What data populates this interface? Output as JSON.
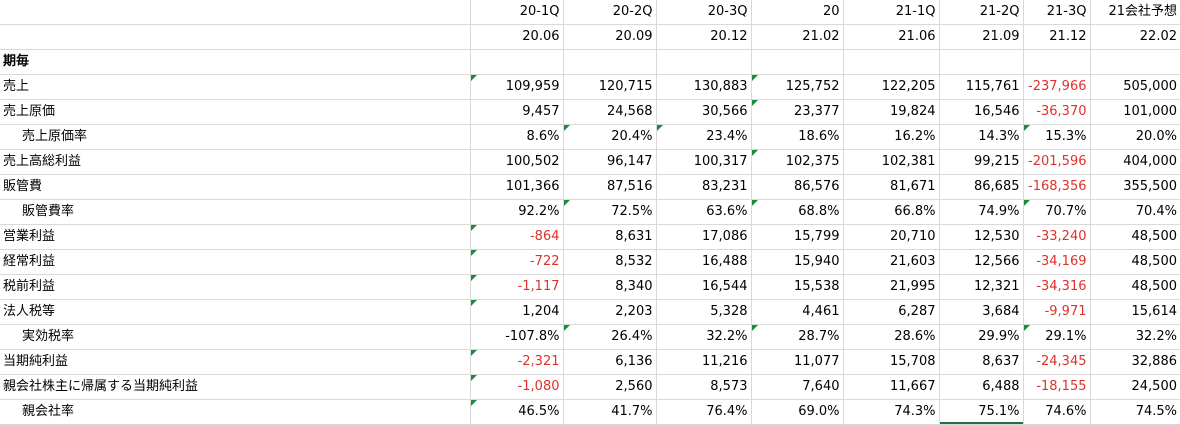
{
  "header": {
    "periods": [
      "20-1Q",
      "20-2Q",
      "20-3Q",
      "20",
      "21-1Q",
      "21-2Q",
      "21-3Q",
      "21会社予想"
    ],
    "dates": [
      "20.06",
      "20.09",
      "20.12",
      "21.02",
      "21.06",
      "21.09",
      "21.12",
      "22.02"
    ]
  },
  "section_label": "期毎",
  "rows": [
    {
      "label": "売上",
      "indent": false,
      "values": [
        "109,959",
        "120,715",
        "130,883",
        "125,752",
        "122,205",
        "115,761",
        "-237,966",
        "505,000"
      ]
    },
    {
      "label": "売上原価",
      "indent": false,
      "values": [
        "9,457",
        "24,568",
        "30,566",
        "23,377",
        "19,824",
        "16,546",
        "-36,370",
        "101,000"
      ]
    },
    {
      "label": "売上原価率",
      "indent": true,
      "values": [
        "8.6%",
        "20.4%",
        "23.4%",
        "18.6%",
        "16.2%",
        "14.3%",
        "15.3%",
        "20.0%"
      ]
    },
    {
      "label": "売上高総利益",
      "indent": false,
      "values": [
        "100,502",
        "96,147",
        "100,317",
        "102,375",
        "102,381",
        "99,215",
        "-201,596",
        "404,000"
      ]
    },
    {
      "label": "販管費",
      "indent": false,
      "values": [
        "101,366",
        "87,516",
        "83,231",
        "86,576",
        "81,671",
        "86,685",
        "-168,356",
        "355,500"
      ]
    },
    {
      "label": "販管費率",
      "indent": true,
      "values": [
        "92.2%",
        "72.5%",
        "63.6%",
        "68.8%",
        "66.8%",
        "74.9%",
        "70.7%",
        "70.4%"
      ]
    },
    {
      "label": "営業利益",
      "indent": false,
      "values": [
        "-864",
        "8,631",
        "17,086",
        "15,799",
        "20,710",
        "12,530",
        "-33,240",
        "48,500"
      ]
    },
    {
      "label": "経常利益",
      "indent": false,
      "values": [
        "-722",
        "8,532",
        "16,488",
        "15,940",
        "21,603",
        "12,566",
        "-34,169",
        "48,500"
      ]
    },
    {
      "label": "税前利益",
      "indent": false,
      "values": [
        "-1,117",
        "8,340",
        "16,544",
        "15,538",
        "21,995",
        "12,321",
        "-34,316",
        "48,500"
      ]
    },
    {
      "label": "法人税等",
      "indent": false,
      "values": [
        "1,204",
        "2,203",
        "5,328",
        "4,461",
        "6,287",
        "3,684",
        "-9,971",
        "15,614"
      ]
    },
    {
      "label": "実効税率",
      "indent": true,
      "values": [
        "-107.8%",
        "26.4%",
        "32.2%",
        "28.7%",
        "28.6%",
        "29.9%",
        "29.1%",
        "32.2%"
      ]
    },
    {
      "label": "当期純利益",
      "indent": false,
      "values": [
        "-2,321",
        "6,136",
        "11,216",
        "11,077",
        "15,708",
        "8,637",
        "-24,345",
        "32,886"
      ]
    },
    {
      "label": "親会社株主に帰属する当期純利益",
      "indent": false,
      "values": [
        "-1,080",
        "2,560",
        "8,573",
        "7,640",
        "11,667",
        "6,488",
        "-18,155",
        "24,500"
      ]
    },
    {
      "label": "親会社率",
      "indent": true,
      "values": [
        "46.5%",
        "41.7%",
        "76.4%",
        "69.0%",
        "74.3%",
        "75.1%",
        "74.6%",
        "74.5%"
      ]
    }
  ],
  "colors": {
    "negative": "#e0312b",
    "marker": "#1e8a3b",
    "grid": "#d9d9d9"
  }
}
